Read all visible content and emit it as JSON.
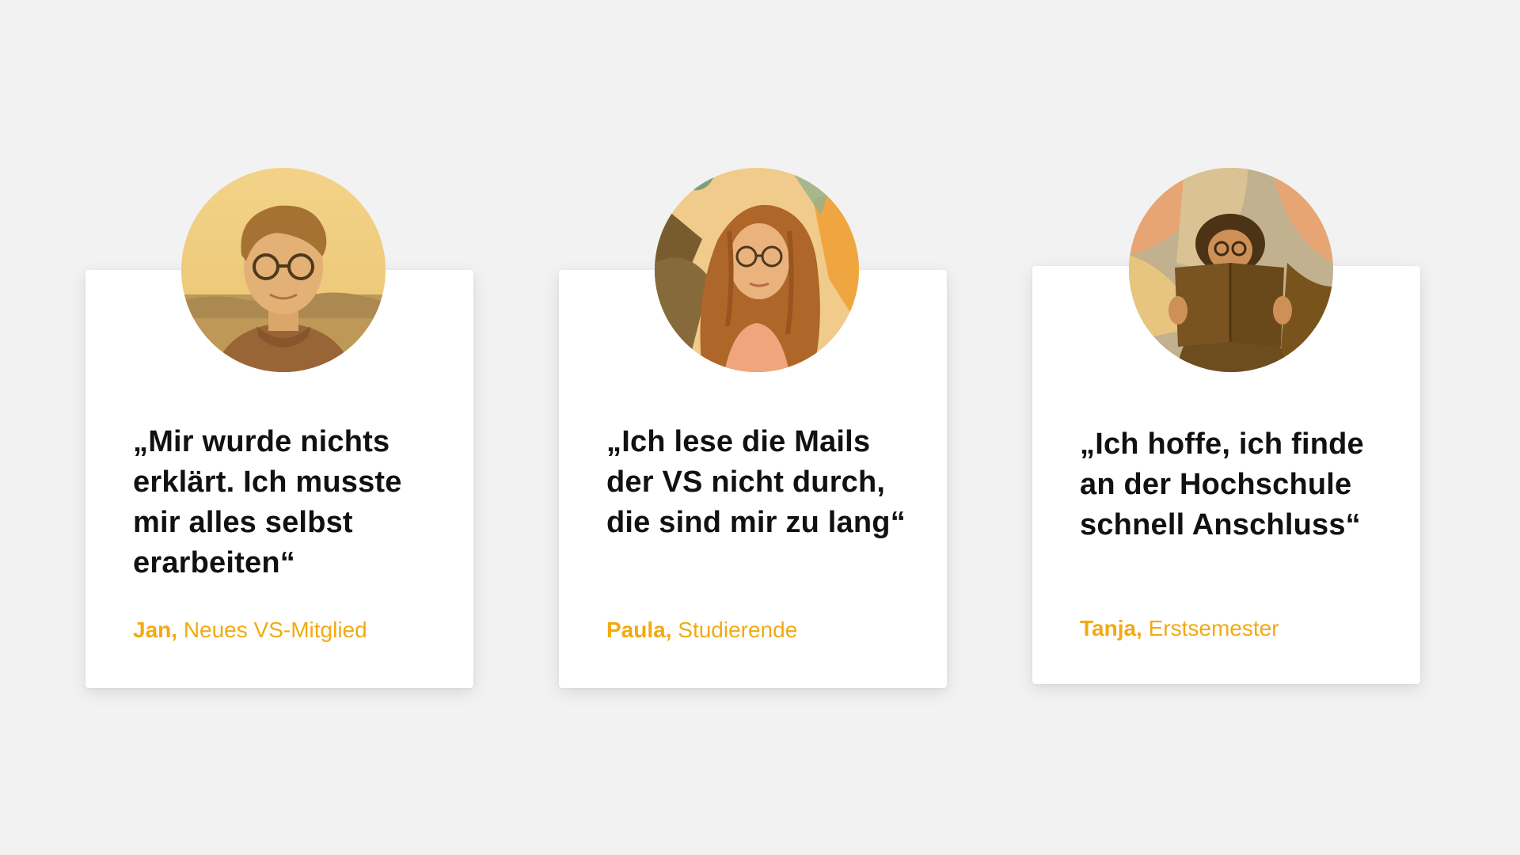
{
  "accent_color": "#f2aa10",
  "testimonials": [
    {
      "quote": "„Mir wurde nichts erklärt. Ich musste mir alles selbst erarbeiten“",
      "name": "Jan,",
      "role": "Neues VS-Mitglied",
      "photo_icon": "portrait-young-man-glasses"
    },
    {
      "quote": "„Ich lese die Mails der VS nicht durch, die sind mir zu lang“",
      "name": "Paula,",
      "role": "Studierende",
      "photo_icon": "portrait-woman-curly-hair-glasses"
    },
    {
      "quote": "„Ich hoffe, ich finde an der Hochschule schnell Anschluss“",
      "name": "Tanja,",
      "role": "Erstsemester",
      "photo_icon": "portrait-woman-reading-book"
    }
  ]
}
